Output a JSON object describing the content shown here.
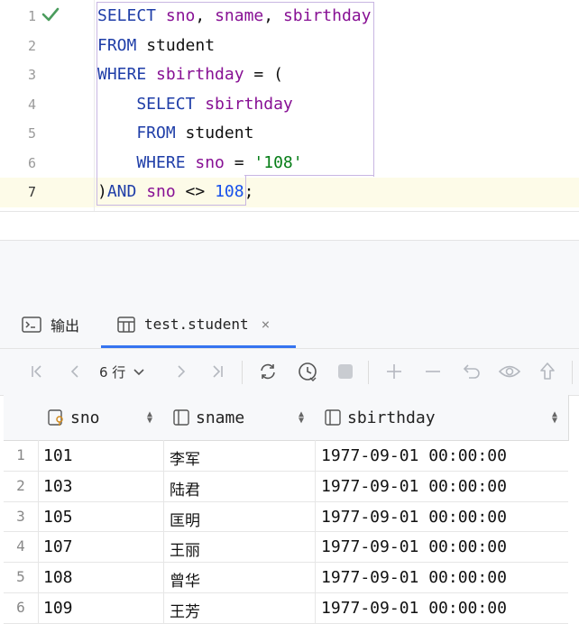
{
  "editor": {
    "line_numbers": [
      "1",
      "2",
      "3",
      "4",
      "5",
      "6",
      "7"
    ],
    "lines": [
      [
        {
          "t": "SELECT ",
          "c": "kw"
        },
        {
          "t": "sno",
          "c": "col"
        },
        {
          "t": ", ",
          "c": ""
        },
        {
          "t": "sname",
          "c": "col"
        },
        {
          "t": ", ",
          "c": ""
        },
        {
          "t": "sbirthday",
          "c": "col"
        }
      ],
      [
        {
          "t": "FROM ",
          "c": "kw"
        },
        {
          "t": "student",
          "c": ""
        }
      ],
      [
        {
          "t": "WHERE ",
          "c": "kw"
        },
        {
          "t": "sbirthday",
          "c": "col"
        },
        {
          "t": " = (",
          "c": ""
        }
      ],
      [
        {
          "t": "    SELECT ",
          "c": "kw"
        },
        {
          "t": "sbirthday",
          "c": "col"
        }
      ],
      [
        {
          "t": "    FROM ",
          "c": "kw"
        },
        {
          "t": "student",
          "c": ""
        }
      ],
      [
        {
          "t": "    WHERE ",
          "c": "kw"
        },
        {
          "t": "sno",
          "c": "col"
        },
        {
          "t": " = ",
          "c": ""
        },
        {
          "t": "'108'",
          "c": "str"
        }
      ],
      [
        {
          "t": ")",
          "c": ""
        },
        {
          "t": "AND ",
          "c": "kw"
        },
        {
          "t": "sno",
          "c": "col"
        },
        {
          "t": " <> ",
          "c": ""
        },
        {
          "t": "108",
          "c": "num"
        },
        {
          "t": ";",
          "c": ""
        }
      ]
    ]
  },
  "tabs": {
    "output_label": "输出",
    "table_label": "test.student",
    "close_symbol": "×"
  },
  "toolbar": {
    "rows_label": "6 行"
  },
  "grid": {
    "columns": [
      "sno",
      "sname",
      "sbirthday"
    ],
    "rows": [
      {
        "n": "1",
        "sno": "101",
        "sname": "李军",
        "sbirthday": "1977-09-01 00:00:00"
      },
      {
        "n": "2",
        "sno": "103",
        "sname": "陆君",
        "sbirthday": "1977-09-01 00:00:00"
      },
      {
        "n": "3",
        "sno": "105",
        "sname": "匡明",
        "sbirthday": "1977-09-01 00:00:00"
      },
      {
        "n": "4",
        "sno": "107",
        "sname": "王丽",
        "sbirthday": "1977-09-01 00:00:00"
      },
      {
        "n": "5",
        "sno": "108",
        "sname": "曾华",
        "sbirthday": "1977-09-01 00:00:00"
      },
      {
        "n": "6",
        "sno": "109",
        "sname": "王芳",
        "sbirthday": "1977-09-01 00:00:00"
      }
    ]
  },
  "colors": {
    "keyword": "#1f3ea8",
    "identifier": "#871094",
    "string": "#067d17",
    "number": "#1750eb",
    "accent": "#3574f0",
    "success": "#4a9c5d"
  }
}
